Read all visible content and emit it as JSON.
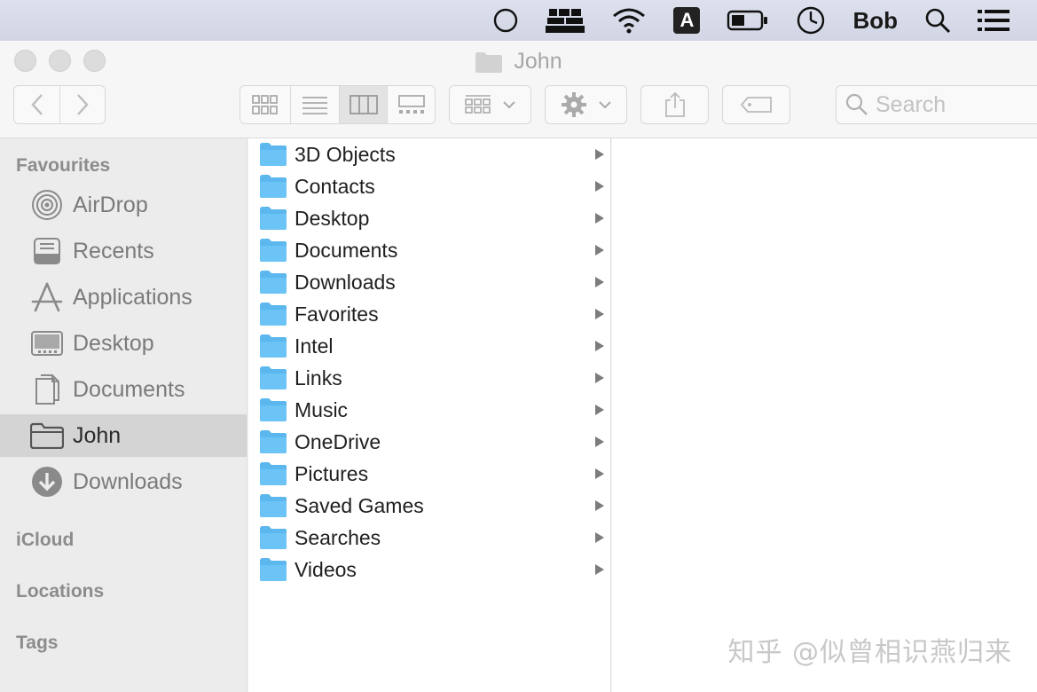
{
  "menubar": {
    "user": "Bob",
    "input_source": "A",
    "icons": [
      "circle-icon",
      "keyboard-stack-icon",
      "wifi-icon",
      "input-source-icon",
      "battery-icon",
      "clock-icon",
      "search-icon",
      "list-icon"
    ]
  },
  "window": {
    "title": "John",
    "search_placeholder": "Search",
    "view_modes": [
      "icon-view",
      "list-view",
      "column-view",
      "gallery-view"
    ],
    "active_view": "column-view"
  },
  "sidebar": {
    "sections": {
      "favourites": "Favourites",
      "icloud": "iCloud",
      "locations": "Locations",
      "tags": "Tags"
    },
    "items": [
      {
        "label": "AirDrop",
        "icon": "airdrop-icon"
      },
      {
        "label": "Recents",
        "icon": "recents-icon"
      },
      {
        "label": "Applications",
        "icon": "applications-icon"
      },
      {
        "label": "Desktop",
        "icon": "desktop-icon"
      },
      {
        "label": "Documents",
        "icon": "document-icon"
      },
      {
        "label": "John",
        "icon": "folder-icon",
        "selected": true
      },
      {
        "label": "Downloads",
        "icon": "download-icon"
      }
    ]
  },
  "column1": {
    "items": [
      "3D Objects",
      "Contacts",
      "Desktop",
      "Documents",
      "Downloads",
      "Favorites",
      "Intel",
      "Links",
      "Music",
      "OneDrive",
      "Pictures",
      "Saved Games",
      "Searches",
      "Videos"
    ]
  },
  "watermark": "知乎 @似曾相识燕归来",
  "colors": {
    "folder": "#6cc3f5",
    "selected": "#d4d4d4"
  }
}
